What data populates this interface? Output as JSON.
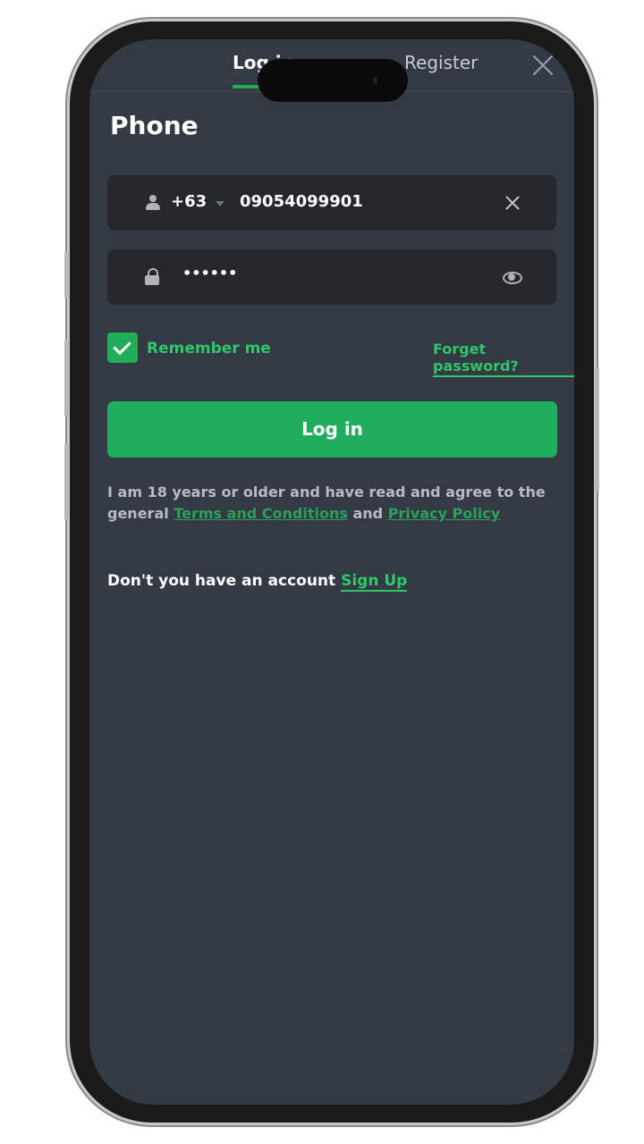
{
  "tabs": {
    "login_label": "Log in",
    "register_label": "Register"
  },
  "page": {
    "title": "Phone"
  },
  "phone_field": {
    "country_code": "+63",
    "value": "09054099901"
  },
  "password_field": {
    "value": "••••••"
  },
  "options": {
    "remember_label": "Remember me",
    "remember_checked": true,
    "forget_label": "Forget password?"
  },
  "actions": {
    "login_label": "Log in"
  },
  "terms": {
    "prefix": "I am 18 years or older and have read and agree to the general",
    "terms_link": "Terms and Conditions",
    "conjunction": "and",
    "privacy_link": "Privacy Policy"
  },
  "signup": {
    "prompt": "Don't you have an account",
    "link": "Sign Up"
  },
  "colors": {
    "accent": "#1fad5a",
    "background": "#333a44",
    "field": "#24272c"
  },
  "icons": [
    "close-icon",
    "user-icon",
    "chevron-down-icon",
    "clear-icon",
    "lock-icon",
    "eye-icon",
    "checkmark-icon"
  ]
}
